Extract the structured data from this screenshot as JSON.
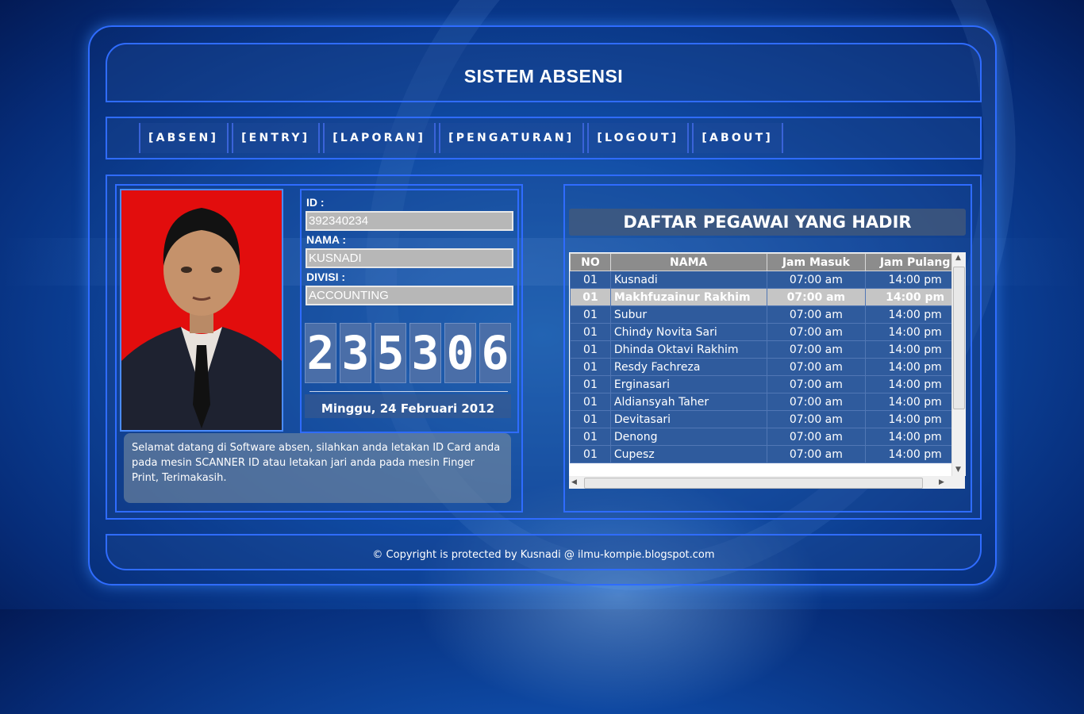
{
  "app": {
    "title": "SISTEM ABSENSI"
  },
  "nav": {
    "items": [
      "[ABSEN]",
      "[ENTRY]",
      "[LAPORAN]",
      "[PENGATURAN]",
      "[LOGOUT]",
      "[ABOUT]"
    ]
  },
  "employee": {
    "id_label": "ID :",
    "id_value": "392340234",
    "name_label": "NAMA :",
    "name_value": "KUSNADI",
    "division_label": "DIVISI :",
    "division_value": "ACCOUNTING"
  },
  "clock": {
    "digits": [
      "2",
      "3",
      "5",
      "3",
      "0",
      "6"
    ],
    "date": "Minggu, 24 Februari 2012"
  },
  "welcome": {
    "text": "Selamat datang di Software absen, silahkan anda letakan ID Card anda pada mesin SCANNER ID atau letakan jari anda pada mesin Finger Print, Terimakasih."
  },
  "attendance": {
    "title": "DAFTAR PEGAWAI YANG HADIR",
    "columns": [
      "NO",
      "NAMA",
      "Jam Masuk",
      "Jam Pulang"
    ],
    "rows": [
      [
        "01",
        "Kusnadi",
        "07:00 am",
        "14:00 pm"
      ],
      [
        "01",
        "Makhfuzainur Rakhim",
        "07:00 am",
        "14:00 pm"
      ],
      [
        "01",
        "Subur",
        "07:00 am",
        "14:00 pm"
      ],
      [
        "01",
        "Chindy Novita Sari",
        "07:00 am",
        "14:00 pm"
      ],
      [
        "01",
        "Dhinda Oktavi Rakhim",
        "07:00 am",
        "14:00 pm"
      ],
      [
        "01",
        "Resdy Fachreza",
        "07:00 am",
        "14:00 pm"
      ],
      [
        "01",
        "Erginasari",
        "07:00 am",
        "14:00 pm"
      ],
      [
        "01",
        "Aldiansyah Taher",
        "07:00 am",
        "14:00 pm"
      ],
      [
        "01",
        "Devitasari",
        "07:00 am",
        "14:00 pm"
      ],
      [
        "01",
        "Denong",
        "07:00 am",
        "14:00 pm"
      ],
      [
        "01",
        "Cupesz",
        "07:00 am",
        "14:00 pm"
      ]
    ],
    "selected_row": 1
  },
  "footer": {
    "text": "© Copyright is protected by Kusnadi @ ilmu-kompie.blogspot.com"
  }
}
